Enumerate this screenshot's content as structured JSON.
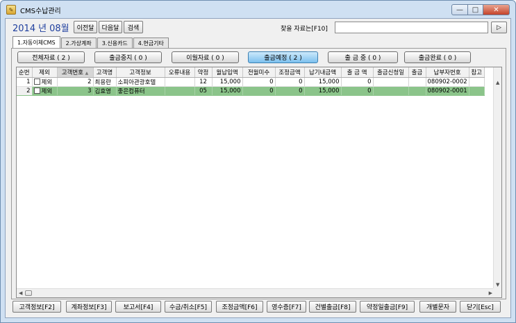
{
  "window": {
    "title": "CMS수납관리",
    "icon": "folder-pencil-icon",
    "controls": {
      "minimize": "—",
      "maximize": "□",
      "close": "✕"
    }
  },
  "period": {
    "year": "2014",
    "year_suffix": "년",
    "month": "08월"
  },
  "nav": {
    "prev_label": "이전달",
    "next_label": "다음달",
    "search_label": "검색"
  },
  "search": {
    "label": "찾을 자료는[F10]",
    "value": "",
    "go_label": "▷"
  },
  "tabs": [
    "1.자동이체CMS",
    "2.가상계좌",
    "3.신용카드",
    "4.현금기타"
  ],
  "filters": [
    {
      "label": "전체자료 ( 2 )"
    },
    {
      "label": "출금중지 ( 0 )"
    },
    {
      "label": "이월자료 ( 0 )"
    },
    {
      "label": "출금예정 ( 2 )"
    },
    {
      "label": "출 금 중 ( 0 )"
    },
    {
      "label": "출금완료 ( 0 )"
    }
  ],
  "table": {
    "headers": [
      "순번",
      "제외",
      "고객번호",
      "고객명",
      "고객정보",
      "오류내용",
      "약정",
      "월납입액",
      "전월미수",
      "조정금액",
      "납기내금액",
      "출 금 액",
      "출금신청일",
      "출금",
      "납부자번호",
      "참고"
    ],
    "sort_indicator": "▲",
    "rows": [
      {
        "seq": "1",
        "exclude": "제외",
        "cust_no": "2",
        "name": "최용란",
        "info": "소피아관광호텔",
        "error": "",
        "contract": "12",
        "monthly": "15,000",
        "prev_unpaid": "0",
        "adjust": "0",
        "due_amount": "15,000",
        "withdraw_amt": "0",
        "withdraw_date": "",
        "withdraw": "",
        "payer_no": "080902-0002",
        "note": ""
      },
      {
        "seq": "2",
        "exclude": "제외",
        "cust_no": "3",
        "name": "김효영",
        "info": "좋은컴퓨터",
        "error": "",
        "contract": "05",
        "monthly": "15,000",
        "prev_unpaid": "0",
        "adjust": "0",
        "due_amount": "15,000",
        "withdraw_amt": "0",
        "withdraw_date": "",
        "withdraw": "",
        "payer_no": "080902-0001",
        "note": ""
      }
    ]
  },
  "bottom_buttons": [
    "고객정보[F2]",
    "계좌정보[F3]",
    "보고서[F4]",
    "수금/취소[F5]",
    "조정금액[F6]",
    "영수증[F7]",
    "건별출금[F8]",
    "약정일출금[F9]",
    "개별문자",
    "닫기[Esc]"
  ],
  "colors": {
    "selected_row": "#8bc48a",
    "active_filter": "#7cc0ee",
    "period_text": "#1f3f9e"
  }
}
